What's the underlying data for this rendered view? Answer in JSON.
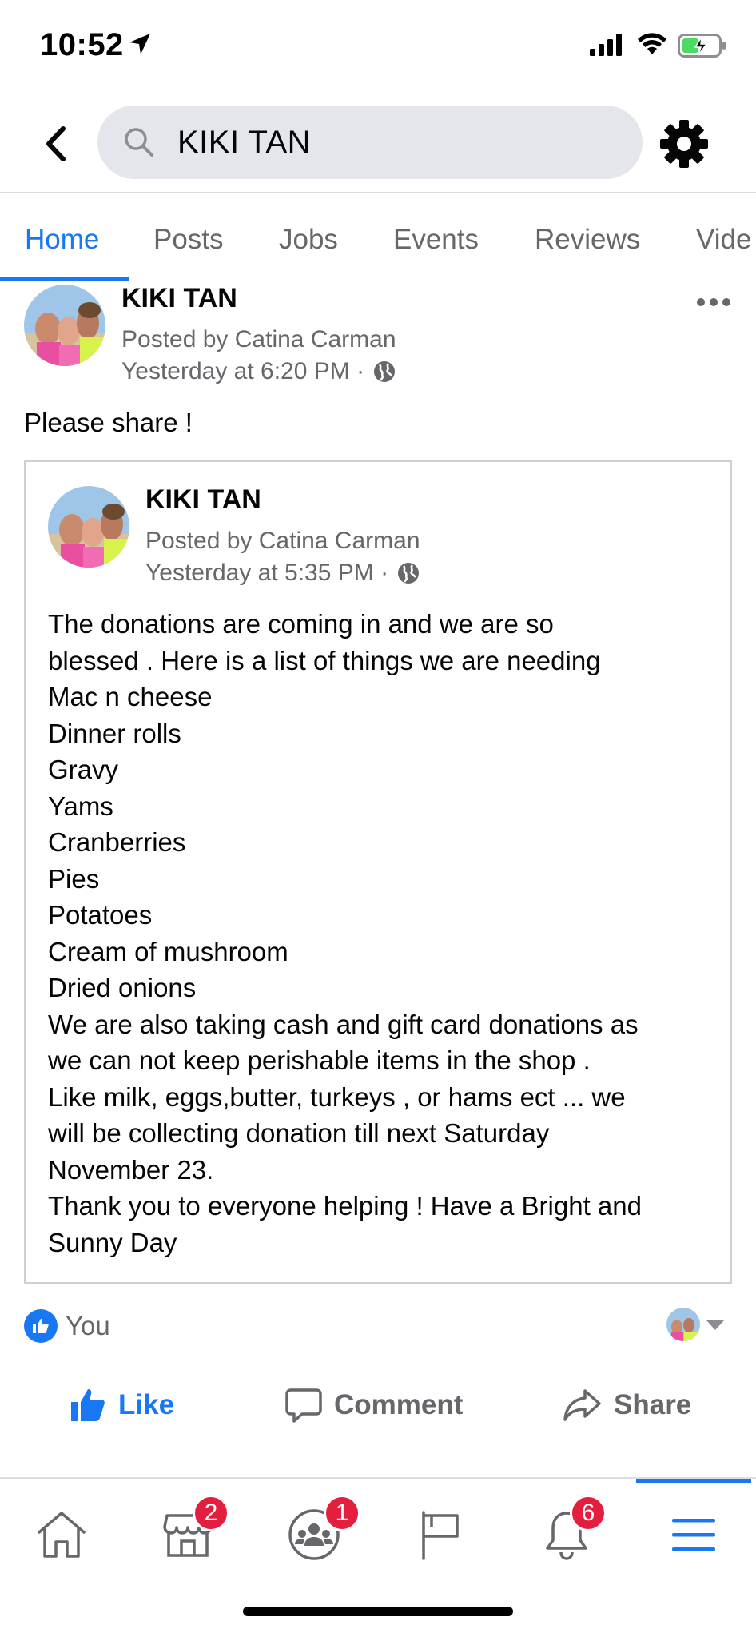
{
  "status_bar": {
    "time": "10:52"
  },
  "search": {
    "query": "KIKI TAN"
  },
  "tabs": [
    {
      "label": "Home",
      "active": true
    },
    {
      "label": "Posts",
      "active": false
    },
    {
      "label": "Jobs",
      "active": false
    },
    {
      "label": "Events",
      "active": false
    },
    {
      "label": "Reviews",
      "active": false
    },
    {
      "label": "Vide",
      "active": false
    }
  ],
  "post": {
    "author": "KIKI TAN",
    "posted_by": "Posted by Catina Carman",
    "timestamp": "Yesterday at 6:20 PM ·",
    "text": "Please share !",
    "shared": {
      "author": "KIKI TAN",
      "posted_by": "Posted by Catina Carman",
      "timestamp": "Yesterday at 5:35 PM ·",
      "lines": [
        "The donations are coming in and we are so",
        "blessed . Here is a list of things we are needing",
        "Mac n cheese",
        "Dinner rolls",
        "Gravy",
        "Yams",
        "Cranberries",
        "Pies",
        "Potatoes",
        "Cream of mushroom",
        "Dried onions",
        "We are also taking cash and gift card donations as",
        "we can not keep perishable items in the shop .",
        "Like milk, eggs,butter, turkeys , or hams ect ... we",
        "will be collecting donation till next Saturday",
        "November 23.",
        "Thank you to everyone helping ! Have a Bright and",
        "Sunny Day"
      ]
    },
    "reactions_text": "You",
    "actions": {
      "like": "Like",
      "comment": "Comment",
      "share": "Share"
    }
  },
  "bottom_nav": {
    "marketplace_badge": "2",
    "groups_badge": "1",
    "notifications_badge": "6"
  },
  "colors": {
    "accent": "#1877f2",
    "badge": "#e41e3f",
    "secondary_text": "#65676b"
  }
}
